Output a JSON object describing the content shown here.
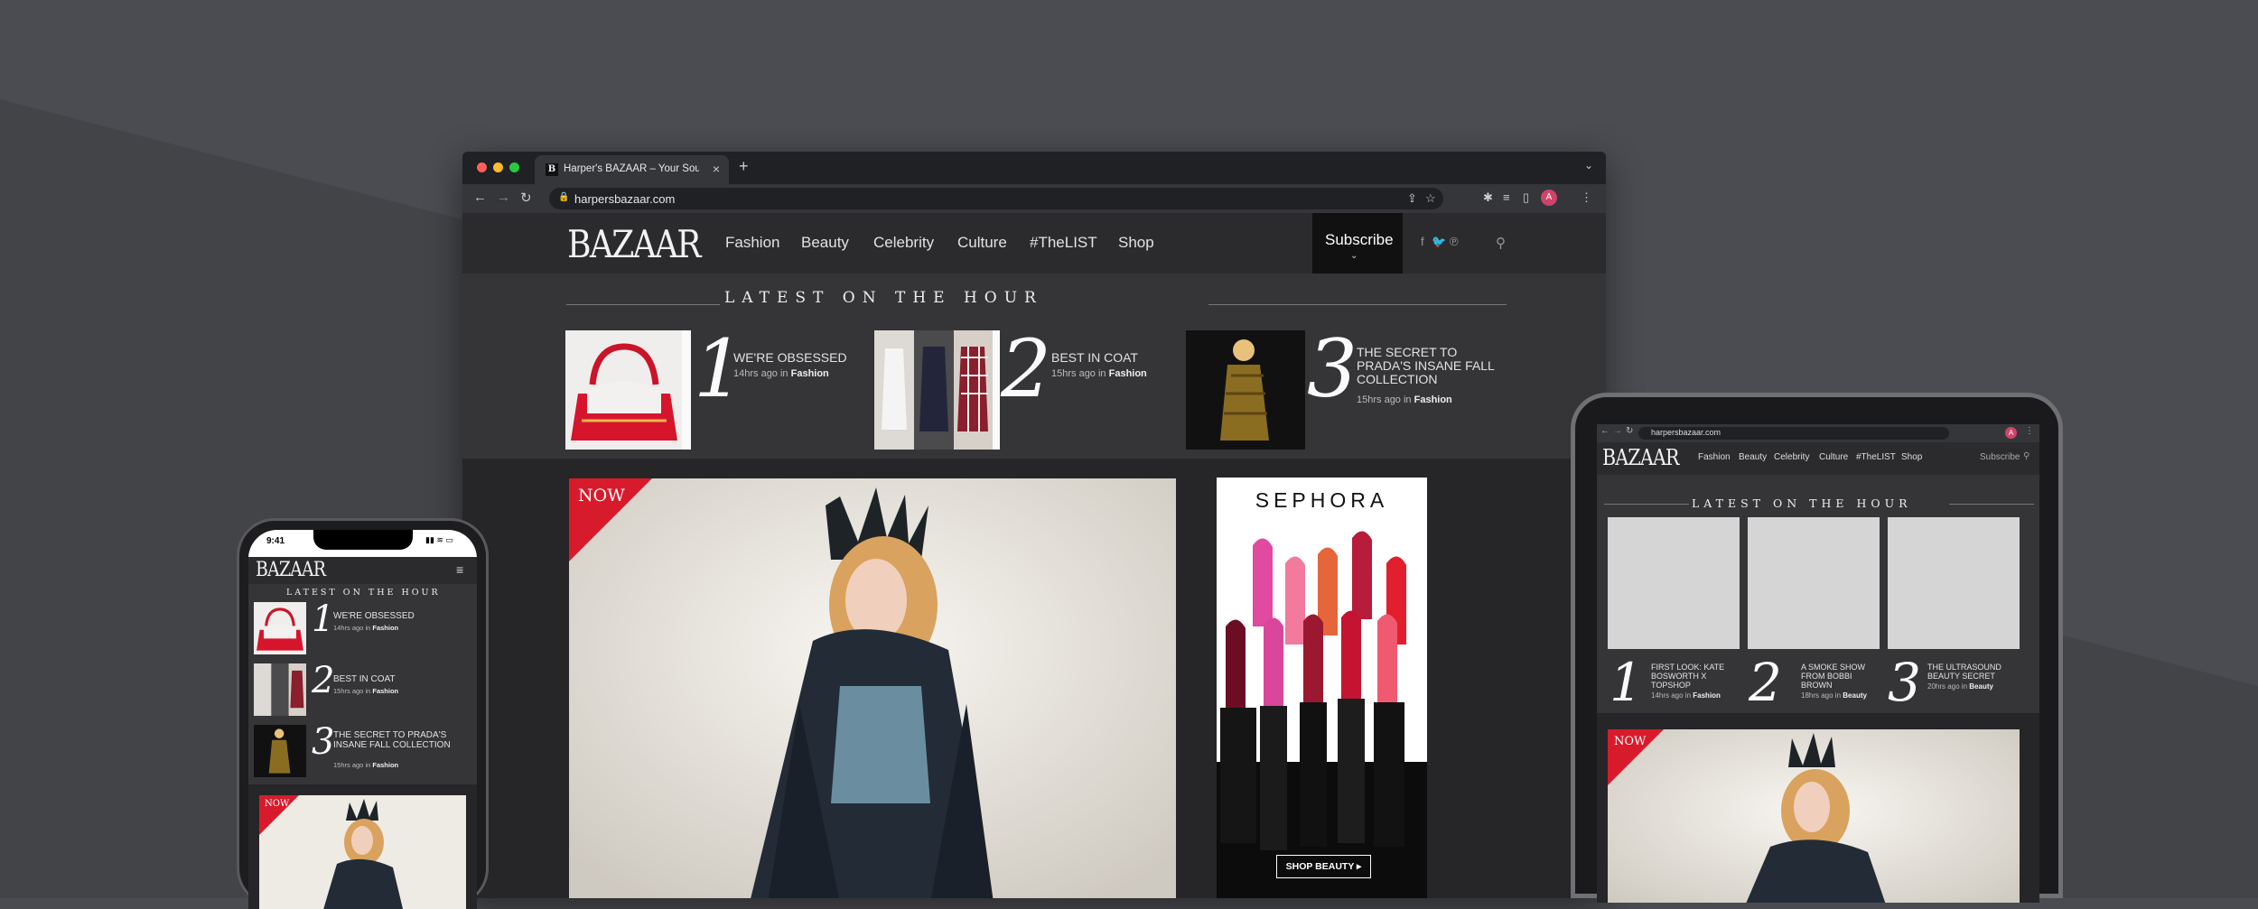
{
  "browser": {
    "tab_title": "Harper's BAZAAR – Your Sourc",
    "favicon_letter": "B",
    "url": "harpersbazaar.com",
    "avatar_letter": "A"
  },
  "site": {
    "logo": "BAZAAR",
    "nav": [
      "Fashion",
      "Beauty",
      "Celebrity",
      "Culture",
      "#TheLIST",
      "Shop"
    ],
    "subscribe": "Subscribe",
    "latest_heading": "LATEST ON THE HOUR",
    "items": [
      {
        "num": "1",
        "title": "WE'RE OBSESSED",
        "time": "14hrs ago in",
        "category": "Fashion"
      },
      {
        "num": "2",
        "title": "BEST IN COAT",
        "time": "15hrs ago in",
        "category": "Fashion"
      },
      {
        "num": "3",
        "title": "THE SECRET TO PRADA'S INSANE FALL COLLECTION",
        "time": "15hrs ago in",
        "category": "Fashion"
      }
    ],
    "hero_badge": "NOW",
    "ad_brand": "SEPHORA",
    "ad_cta": "SHOP BEAUTY ▸"
  },
  "phone": {
    "time": "9:41",
    "logo": "BAZAAR",
    "latest_heading": "LATEST ON THE HOUR",
    "items": [
      {
        "num": "1",
        "title": "WE'RE OBSESSED",
        "time": "14hrs ago in",
        "category": "Fashion"
      },
      {
        "num": "2",
        "title": "BEST IN COAT",
        "time": "15hrs ago in",
        "category": "Fashion"
      },
      {
        "num": "3",
        "title": "THE SECRET TO PRADA'S INSANE FALL COLLECTION",
        "time": "15hrs ago in",
        "category": "Fashion"
      }
    ],
    "hero_badge": "NOW"
  },
  "tablet": {
    "url": "harpersbazaar.com",
    "avatar_letter": "A",
    "logo": "BAZAAR",
    "nav": [
      "Fashion",
      "Beauty",
      "Celebrity",
      "Culture",
      "#TheLIST",
      "Shop"
    ],
    "subscribe": "Subscribe",
    "latest_heading": "LATEST ON THE HOUR",
    "items": [
      {
        "num": "1",
        "title": "FIRST LOOK: KATE BOSWORTH X TOPSHOP",
        "time": "14hrs ago in",
        "category": "Fashion"
      },
      {
        "num": "2",
        "title": "A SMOKE SHOW FROM BOBBI BROWN",
        "time": "18hrs ago in",
        "category": "Beauty"
      },
      {
        "num": "3",
        "title": "THE ULTRASOUND BEAUTY SECRET",
        "time": "20hrs ago in",
        "category": "Beauty"
      }
    ],
    "hero_badge": "NOW"
  }
}
